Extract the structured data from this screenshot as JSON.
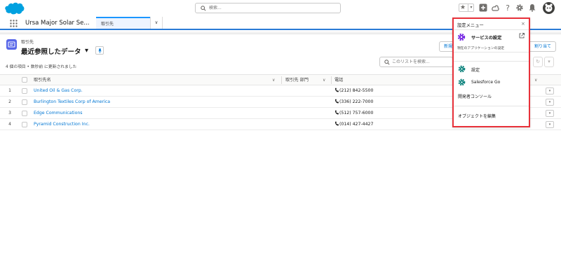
{
  "header": {
    "search_placeholder": "検索...",
    "brand_color": "#00a1e0"
  },
  "app_nav": {
    "app_name": "Ursa Major Solar Se...",
    "tab_label": "取引先"
  },
  "list_view": {
    "object_label": "取引先",
    "view_name": "最近参照したデータ",
    "meta": "4 個の項目 • 数秒前 に更新されました",
    "new_button": "新規",
    "assign_button": "割り当て",
    "search_placeholder": "このリストを検索...",
    "columns": [
      "取引先名",
      "取引先 部門",
      "電話"
    ],
    "rows": [
      {
        "num": "1",
        "name": "United Oil & Gas Corp.",
        "phone": "(212) 842-5500"
      },
      {
        "num": "2",
        "name": "Burlington Textiles Corp of America",
        "phone": "(336) 222-7000"
      },
      {
        "num": "3",
        "name": "Edge Communications",
        "phone": "(512) 757-6000"
      },
      {
        "num": "4",
        "name": "Pyramid Construction Inc.",
        "phone": "(014) 427-4427"
      }
    ]
  },
  "setup_menu": {
    "title": "設定メニュー",
    "close": "×",
    "services_title": "サービスの設定",
    "services_subtitle": "現在のアプリケーションの設定",
    "items": [
      {
        "label": "設定",
        "icon": "gear-icon"
      },
      {
        "label": "Salesforce Go",
        "icon": "gear-icon"
      },
      {
        "label": "開発者コンソール",
        "icon": ""
      },
      {
        "label": "オブジェクトを編集",
        "icon": ""
      }
    ],
    "highlight_color": "#e8313a",
    "gear_color": "#0b827c",
    "services_icon_color": "#7526e3"
  }
}
